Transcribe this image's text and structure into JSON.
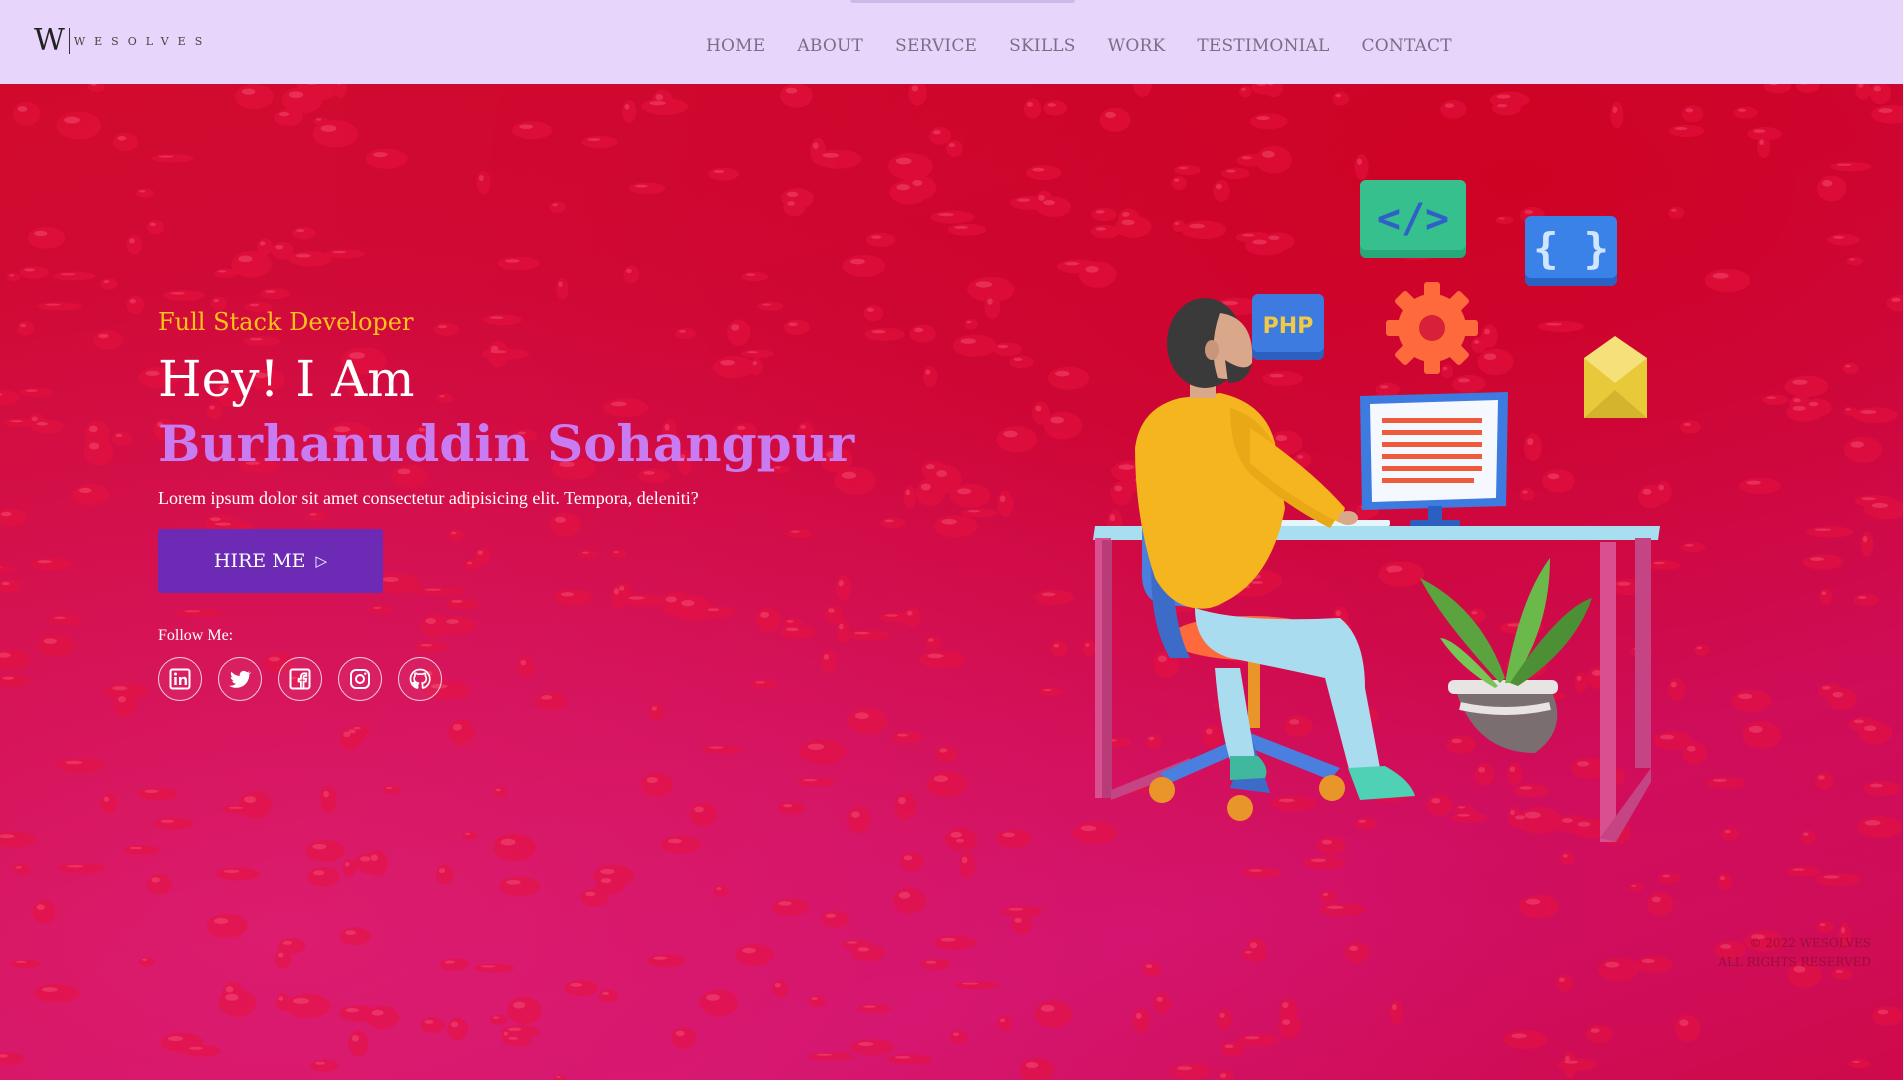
{
  "header": {
    "logo_letter": "W",
    "logo_name": "WESOLVES",
    "nav": [
      "HOME",
      "ABOUT",
      "SERVICE",
      "SKILLS",
      "WORK",
      "TESTIMONIAL",
      "CONTACT"
    ]
  },
  "hero": {
    "role": "Full Stack Developer",
    "greeting": "Hey! I Am",
    "name": "Burhanuddin Sohangpur",
    "description": "Lorem ipsum dolor sit amet consectetur adipisicing elit. Tempora, deleniti?",
    "cta_label": "HIRE ME",
    "cta_icon": "play-outline-icon",
    "follow_label": "Follow Me:",
    "socials": [
      "linkedin-icon",
      "twitter-icon",
      "facebook-icon",
      "instagram-icon",
      "github-icon"
    ]
  },
  "illustration": {
    "badges": [
      "</>",
      "{ }",
      "PHP"
    ]
  },
  "footer": {
    "copyright_line1": "© 2022 WESOLVES",
    "copyright_line2": "ALL RIGHTS RESERVED"
  },
  "colors": {
    "header_bg": "#e8d5fb",
    "accent_yellow": "#ffc21a",
    "accent_purple": "#c97cf2",
    "button_bg": "#6d2ab5",
    "hero_bg": "#c8104a"
  }
}
